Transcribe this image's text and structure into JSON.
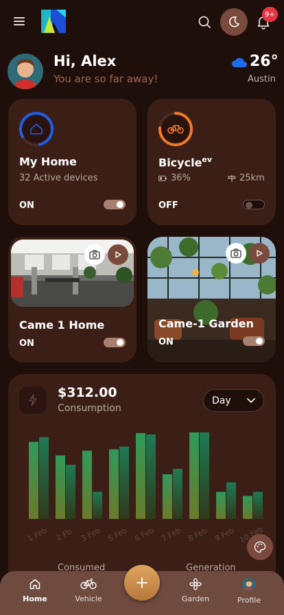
{
  "header": {
    "notification_count": "9+"
  },
  "greeting": {
    "title": "Hi, Alex",
    "subtitle": "You are so far away!",
    "temperature": "26°",
    "city": "Austin",
    "weather_icon": "cloud-icon",
    "weather_color": "#1e6cf0"
  },
  "cards": {
    "home": {
      "title": "My Home",
      "subtitle": "32 Active devices",
      "state": "ON",
      "toggle_on": true,
      "accent": "#1e5ee8"
    },
    "bicycle": {
      "title": "Bicycle",
      "title_sup": "ev",
      "battery": "36%",
      "range": "25km",
      "state": "OFF",
      "toggle_on": false,
      "accent": "#f07a2a"
    },
    "camera1": {
      "title": "Came 1 Home",
      "state": "ON",
      "toggle_on": true
    },
    "camera2": {
      "title": "Came-1 Garden",
      "state": "ON",
      "toggle_on": true
    }
  },
  "consumption": {
    "value": "$312.00",
    "label": "Consumption",
    "period": "Day",
    "footer_left": "Consumed",
    "footer_right": "Generation"
  },
  "chart_data": {
    "type": "bar",
    "categories": [
      "1 Feb",
      "2 Fb",
      "3 Feb",
      "5 Feb",
      "6 Feb",
      "7 Feb",
      "8 Feb",
      "9 Feb",
      "10 Feb"
    ],
    "series": [
      {
        "values": [
          114,
          94,
          101,
          103,
          127,
          66,
          128,
          40,
          34
        ]
      },
      {
        "values": [
          121,
          80,
          40,
          107,
          125,
          74,
          128,
          54,
          40
        ]
      }
    ],
    "ylim": [
      0,
      130
    ],
    "grid": false
  },
  "nav": {
    "items": [
      {
        "label": "Home",
        "icon": "home-icon",
        "active": true
      },
      {
        "label": "Vehicle",
        "icon": "bicycle-icon",
        "active": false
      },
      {
        "label": "Garden",
        "icon": "flower-icon",
        "active": false
      },
      {
        "label": "Profile",
        "icon": "avatar",
        "active": false
      }
    ]
  },
  "colors": {
    "background": "#1f0f0b",
    "card": "#3b1f17",
    "accent_brown": "#7a4a3c",
    "fab": "#d39a55",
    "nav": "#6f4a3f"
  }
}
